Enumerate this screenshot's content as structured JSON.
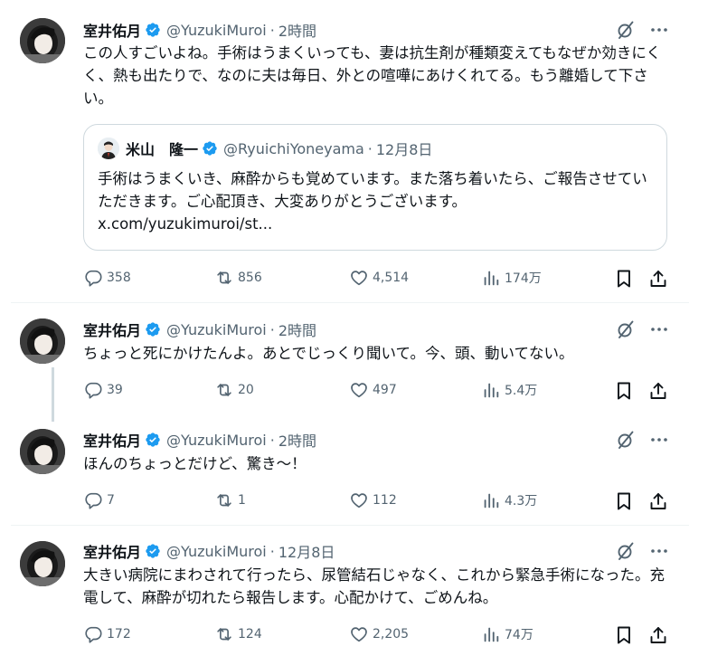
{
  "colors": {
    "text": "#0f1419",
    "muted": "#536471",
    "verified": "#1d9bf0",
    "border": "#cfd9de"
  },
  "tweets": [
    {
      "name": "室井佑月",
      "handle": "@YuzukiMuroi",
      "dot": "·",
      "time": "2時間",
      "text": "この人すごいよね。手術はうまくいっても、妻は抗生剤が種類変えてもなぜか効きにくく、熱も出たりで、なのに夫は毎日、外との喧嘩にあけくれてる。もう離婚して下さい。",
      "quote": {
        "name": "米山　隆一",
        "handle": "@RyuichiYoneyama",
        "dot": "·",
        "time": "12月8日",
        "text": "手術はうまくいき、麻酔からも覚めています。また落ち着いたら、ご報告させていただきます。ご心配頂き、大変ありがとうございます。",
        "link": "x.com/yuzukimuroi/st..."
      },
      "replies": "358",
      "retweets": "856",
      "likes": "4,514",
      "views": "174万"
    },
    {
      "name": "室井佑月",
      "handle": "@YuzukiMuroi",
      "dot": "·",
      "time": "2時間",
      "text": "ちょっと死にかけたんよ。あとでじっくり聞いて。今、頭、動いてない。",
      "replies": "39",
      "retweets": "20",
      "likes": "497",
      "views": "5.4万"
    },
    {
      "name": "室井佑月",
      "handle": "@YuzukiMuroi",
      "dot": "·",
      "time": "2時間",
      "text": "ほんのちょっとだけど、驚き～！",
      "replies": "7",
      "retweets": "1",
      "likes": "112",
      "views": "4.3万"
    },
    {
      "name": "室井佑月",
      "handle": "@YuzukiMuroi",
      "dot": "·",
      "time": "12月8日",
      "text": "大きい病院にまわされて行ったら、尿管結石じゃなく、これから緊急手術になった。充電して、麻酔が切れたら報告します。心配かけて、ごめんね。",
      "replies": "172",
      "retweets": "124",
      "likes": "2,205",
      "views": "74万"
    }
  ]
}
